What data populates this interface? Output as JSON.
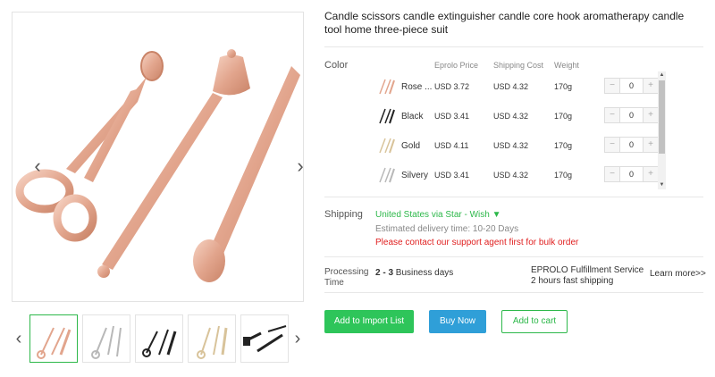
{
  "product": {
    "title": "Candle scissors candle extinguisher candle core hook aromatherapy candle tool home three-piece suit"
  },
  "gallery": {
    "thumbnails": [
      {
        "name": "Rose Gold"
      },
      {
        "name": "Silvery"
      },
      {
        "name": "Black"
      },
      {
        "name": "Gold"
      },
      {
        "name": "Black set"
      }
    ]
  },
  "variants": {
    "label": "Color",
    "headers": {
      "price": "Eprolo Price",
      "shipping": "Shipping Cost",
      "weight": "Weight"
    },
    "rows": [
      {
        "name": "Rose ...",
        "price": "USD 3.72",
        "shipping": "USD 4.32",
        "weight": "170g",
        "qty": "0",
        "color": "#d9a08a"
      },
      {
        "name": "Black",
        "price": "USD 3.41",
        "shipping": "USD 4.32",
        "weight": "170g",
        "qty": "0",
        "color": "#222222"
      },
      {
        "name": "Gold",
        "price": "USD 4.11",
        "shipping": "USD 4.32",
        "weight": "170g",
        "qty": "0",
        "color": "#d8c39a"
      },
      {
        "name": "Silvery",
        "price": "USD 3.41",
        "shipping": "USD 4.32",
        "weight": "170g",
        "qty": "0",
        "color": "#b8b8b8"
      }
    ],
    "minus": "−",
    "plus": "+"
  },
  "shipping": {
    "label": "Shipping",
    "method": "United States via Star - Wish ▼",
    "delivery": "Estimated delivery time: 10-20 Days",
    "bulk_notice": "Please contact our support agent first for bulk order"
  },
  "processing": {
    "label": "Processing Time",
    "range": "2 - 3",
    "unit": "Business days",
    "service_title": "EPROLO Fulfillment Service",
    "service_sub": "2 hours fast shipping",
    "learn_more": "Learn more>>"
  },
  "actions": {
    "import": "Add to Import List",
    "buy": "Buy Now",
    "cart": "Add to cart"
  },
  "colors": {
    "rose_gold": "#e2a58d",
    "green": "#2db84a",
    "blue": "#2f9fd8",
    "red": "#e02020"
  }
}
